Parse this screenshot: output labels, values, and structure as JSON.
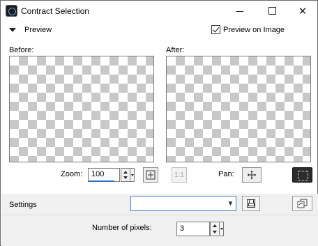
{
  "window": {
    "title": "Contract Selection",
    "icon": "app-icon",
    "controls": {
      "minimize": "minimize-icon",
      "maximize": "maximize-icon",
      "close": "close-icon"
    }
  },
  "preview": {
    "section_label": "Preview",
    "preview_on_image_label": "Preview on Image",
    "preview_on_image_checked": true
  },
  "panes": {
    "before_label": "Before:",
    "after_label": "After:"
  },
  "toolbar": {
    "zoom_label": "Zoom:",
    "zoom_value": "100",
    "fit_icon": "zoom-fit-icon",
    "actual_size_label": "1:1",
    "pan_label": "Pan:",
    "pan_icon": "move-arrows-icon",
    "selection_icon": "marquee-selection-icon"
  },
  "settings": {
    "label": "Settings",
    "preset_value": "",
    "save_icon": "floppy-disk-icon",
    "load_icon": "preset-manager-icon"
  },
  "params": {
    "pixels_label": "Number of pixels:",
    "pixels_value": "3"
  },
  "colors": {
    "accent": "#3c7fd1",
    "checker": "#c8c8c8",
    "band_bg": "#f0f0f0"
  }
}
